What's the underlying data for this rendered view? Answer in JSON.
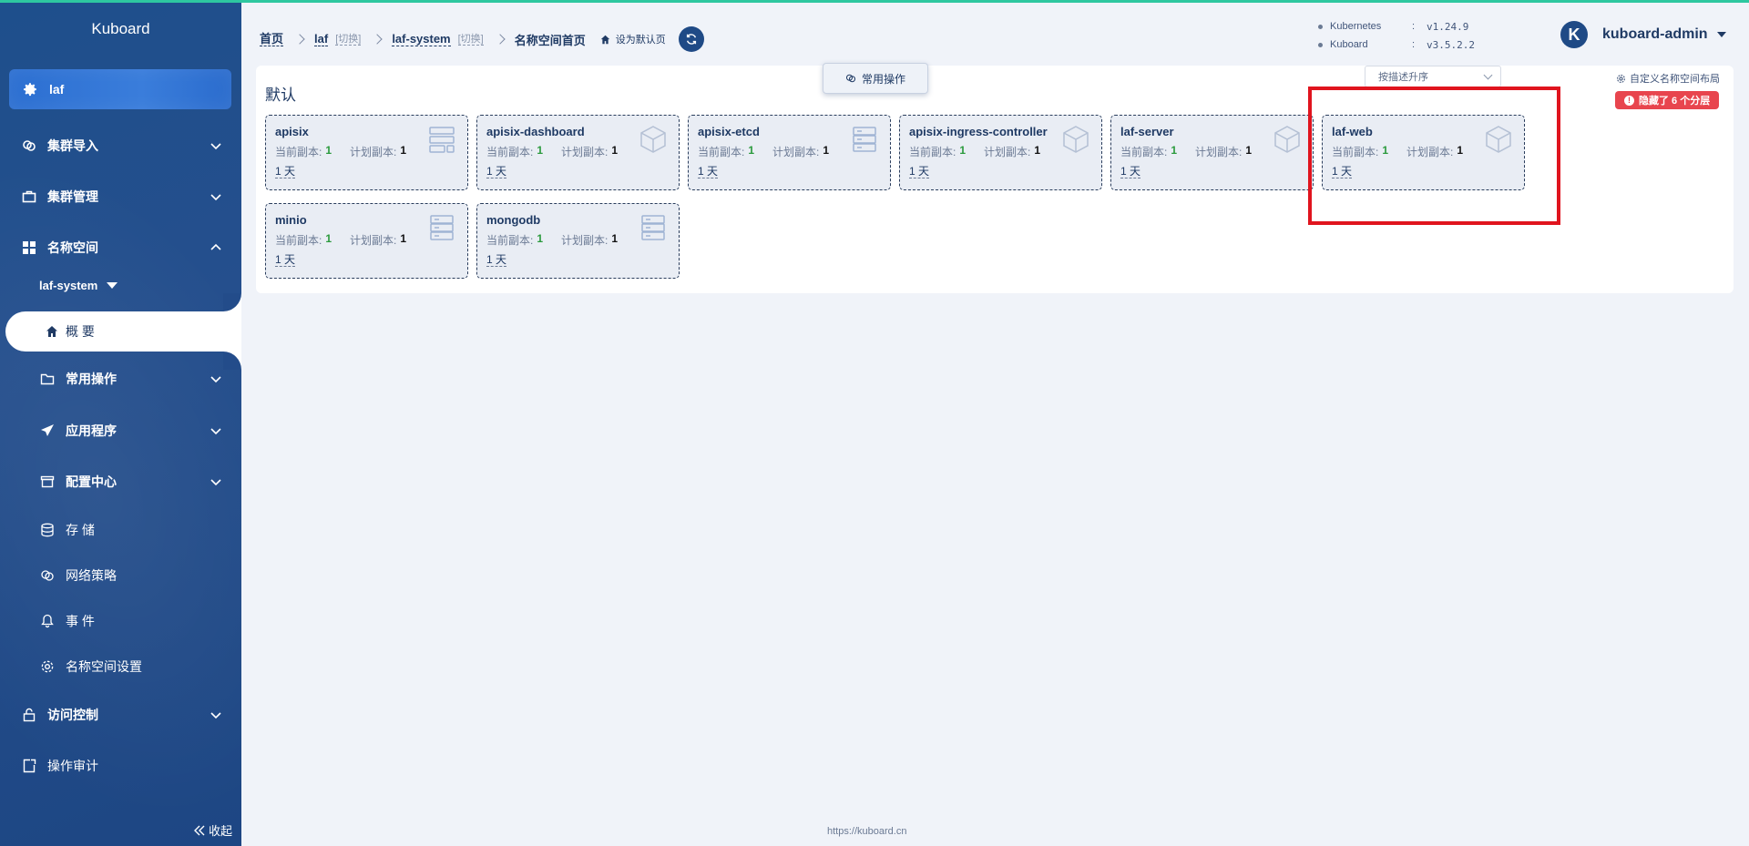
{
  "app": {
    "brand": "Kuboard",
    "footer_url": "https://kuboard.cn"
  },
  "sidebar": {
    "cluster": "laf",
    "items": [
      {
        "label": "集群导入"
      },
      {
        "label": "集群管理"
      },
      {
        "label": "名称空间"
      }
    ],
    "namespace_select": "laf-system",
    "active": "概 要",
    "sub_items": [
      {
        "label": "常用操作"
      },
      {
        "label": "应用程序"
      },
      {
        "label": "配置中心"
      },
      {
        "label": "存 储"
      },
      {
        "label": "网络策略"
      },
      {
        "label": "事 件"
      },
      {
        "label": "名称空间设置"
      }
    ],
    "bottom_items": [
      {
        "label": "访问控制"
      },
      {
        "label": "操作审计"
      }
    ],
    "collapse_label": "收起"
  },
  "header": {
    "breadcrumb": {
      "home": "首页",
      "cluster": "laf",
      "cluster_switch": "[切换]",
      "namespace": "laf-system",
      "namespace_switch": "[切换]",
      "current": "名称空间首页",
      "set_default": "设为默认页"
    },
    "versions": [
      {
        "name": "Kubernetes",
        "colon": ":",
        "value": "v1.24.9"
      },
      {
        "name": "Kuboard",
        "colon": ":",
        "value": "v3.5.2.2"
      }
    ],
    "user": {
      "avatar_letter": "K",
      "name": "kuboard-admin"
    }
  },
  "main": {
    "group_title": "默认",
    "common_ops_label": "常用操作",
    "sort_select": "按描述升序",
    "custom_layout": "自定义名称空间布局",
    "hidden_badge": "隐藏了 6 个分层",
    "current_label": "当前副本:",
    "planned_label": "计划副本:",
    "cards": [
      {
        "name": "apisix",
        "current": "1",
        "planned": "1",
        "age": "1 天",
        "icon": "server-icon"
      },
      {
        "name": "apisix-dashboard",
        "current": "1",
        "planned": "1",
        "age": "1 天",
        "icon": "cube-icon"
      },
      {
        "name": "apisix-etcd",
        "current": "1",
        "planned": "1",
        "age": "1 天",
        "icon": "database-icon"
      },
      {
        "name": "apisix-ingress-controller",
        "current": "1",
        "planned": "1",
        "age": "1 天",
        "icon": "cube-icon"
      },
      {
        "name": "laf-server",
        "current": "1",
        "planned": "1",
        "age": "1 天",
        "icon": "cube-icon"
      },
      {
        "name": "laf-web",
        "current": "1",
        "planned": "1",
        "age": "1 天",
        "icon": "cube-icon"
      },
      {
        "name": "minio",
        "current": "1",
        "planned": "1",
        "age": "1 天",
        "icon": "database-icon"
      },
      {
        "name": "mongodb",
        "current": "1",
        "planned": "1",
        "age": "1 天",
        "icon": "database-icon"
      }
    ]
  },
  "colors": {
    "sidebar": "#234c8a",
    "accent": "#2ec7a0",
    "highlight": "#e0141e",
    "badge": "#e8454e",
    "current_count": "#2a9a3c"
  }
}
